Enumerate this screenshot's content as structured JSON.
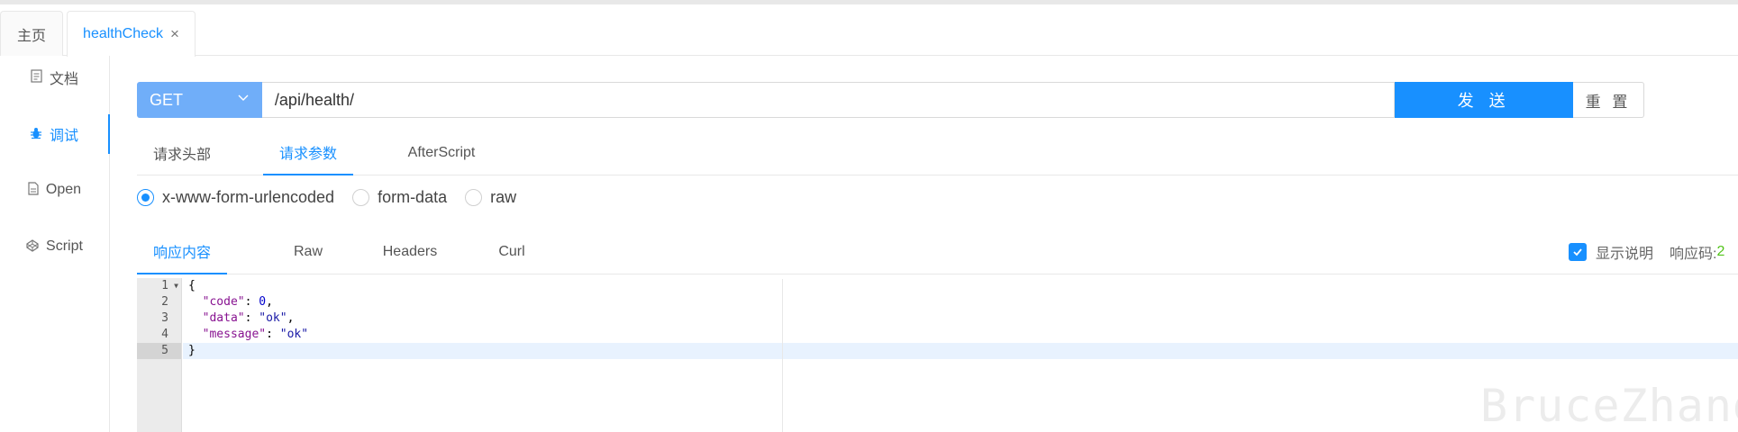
{
  "tabs": [
    {
      "label": "主页"
    },
    {
      "label": "healthCheck",
      "close": "×"
    }
  ],
  "sidebar": {
    "items": [
      {
        "label": "文档",
        "icon": "doc-icon"
      },
      {
        "label": "调试",
        "icon": "bug-icon"
      },
      {
        "label": "Open",
        "icon": "file-icon"
      },
      {
        "label": "Script",
        "icon": "codepen-icon"
      }
    ]
  },
  "request": {
    "method": "GET",
    "url": "/api/health/",
    "send_label": "发 送",
    "reset_label": "重 置"
  },
  "request_tabs": [
    "请求头部",
    "请求参数",
    "AfterScript"
  ],
  "body_types": [
    "x-www-form-urlencoded",
    "form-data",
    "raw"
  ],
  "response_tabs": [
    "响应内容",
    "Raw",
    "Headers",
    "Curl"
  ],
  "response_options": {
    "show_desc_label": "显示说明",
    "code_label": "响应码:",
    "code_value": "2"
  },
  "editor": {
    "line_numbers": [
      "1",
      "2",
      "3",
      "4",
      "5"
    ],
    "lines": {
      "l1": "{",
      "l2_key": "\"code\"",
      "l2_val": "0",
      "l3_key": "\"data\"",
      "l3_val": "\"ok\"",
      "l4_key": "\"message\"",
      "l4_val": "\"ok\"",
      "l5": "}"
    }
  },
  "watermark": "BruceZhang",
  "colors": {
    "primary": "#1890ff",
    "method_bg": "#70aef9",
    "success": "#52c41a"
  }
}
